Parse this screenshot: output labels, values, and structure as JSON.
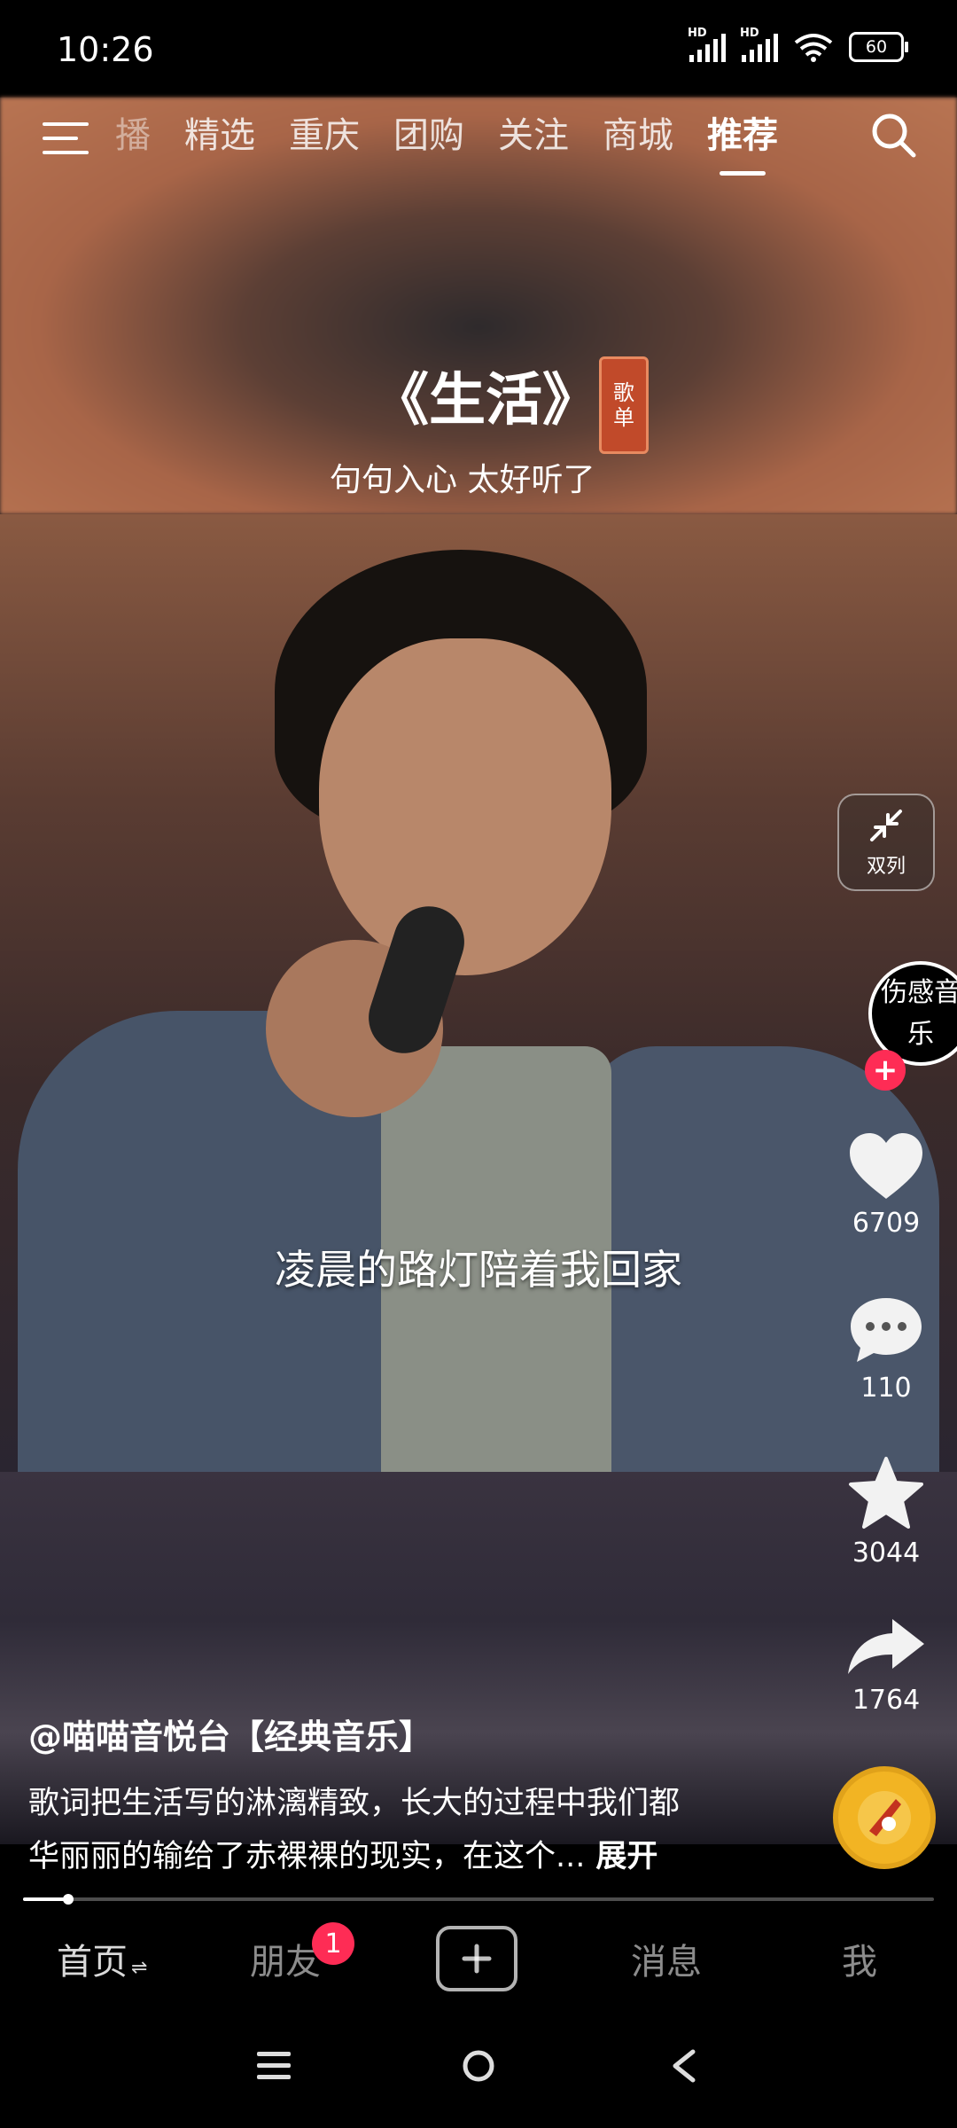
{
  "status_bar": {
    "time": "10:26",
    "signal1_label": "HD",
    "signal2_label": "HD",
    "battery": "60"
  },
  "top_nav": {
    "tabs": [
      "播",
      "精选",
      "重庆",
      "团购",
      "关注",
      "商城",
      "推荐"
    ],
    "active_tab": "推荐"
  },
  "video": {
    "title": "《生活》",
    "tag_line1": "歌",
    "tag_line2": "单",
    "subtitle": "句句入心 太好听了",
    "lyric": "凌晨的路灯陪着我回家",
    "progress": 0.05
  },
  "side_actions": {
    "dual_column_label": "双列",
    "avatar_text": [
      "伤",
      "感",
      "音",
      "乐"
    ],
    "follow_symbol": "+",
    "likes": "6709",
    "comments": "110",
    "favorites": "3044",
    "shares": "1764"
  },
  "post": {
    "author": "@喵喵音悦台【经典音乐】",
    "description_line1": "歌词把生活写的淋漓精致，长大的过程中我们都",
    "description_line2": "华丽丽的输给了赤裸裸的现实，在这个...",
    "expand_label": "展开"
  },
  "bottom_bar": {
    "home": "首页",
    "home_suffix": "⇌",
    "friends": "朋友",
    "friends_badge": "1",
    "messages": "消息",
    "me": "我"
  },
  "colors": {
    "accent": "#fe2c55",
    "background": "#000000"
  }
}
